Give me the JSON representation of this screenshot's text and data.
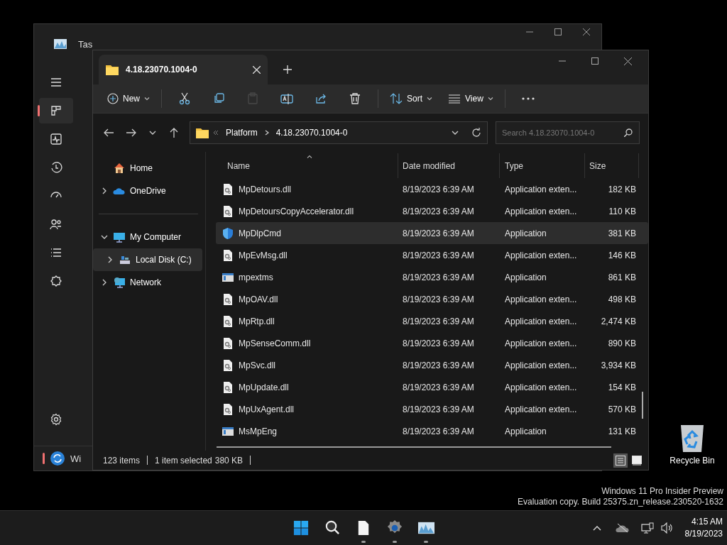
{
  "desktop": {
    "icons": [
      {
        "label": "Recycle Bin"
      }
    ],
    "watermark": [
      "Windows 11 Pro Insider Preview",
      "Evaluation copy. Build 25375.zn_release.230520-1632"
    ]
  },
  "background_window": {
    "title": "Tas",
    "sidebar": [
      {
        "kind": "menu",
        "selected": false
      },
      {
        "kind": "processes",
        "selected": true
      },
      {
        "kind": "performance",
        "selected": false
      },
      {
        "kind": "history",
        "selected": false
      },
      {
        "kind": "startup",
        "selected": false
      },
      {
        "kind": "users",
        "selected": false
      },
      {
        "kind": "details",
        "selected": false
      },
      {
        "kind": "services",
        "selected": false
      }
    ],
    "footer_item": "Wi"
  },
  "explorer": {
    "tab": {
      "title": "4.18.23070.1004-0"
    },
    "toolbar": {
      "new": "New",
      "actions": [
        {
          "kind": "cut",
          "disabled": false
        },
        {
          "kind": "copy",
          "disabled": false
        },
        {
          "kind": "paste",
          "disabled": true
        },
        {
          "kind": "rename",
          "disabled": false
        },
        {
          "kind": "share",
          "disabled": false
        },
        {
          "kind": "delete",
          "disabled": false
        }
      ],
      "sort": "Sort",
      "view": "View"
    },
    "address": {
      "breadcrumbs": [
        "Platform",
        "4.18.23070.1004-0"
      ]
    },
    "search": {
      "placeholder": "Search 4.18.23070.1004-0"
    },
    "navigation": [
      [
        {
          "label": "Home",
          "kind": "home",
          "selected": false
        },
        {
          "label": "OneDrive",
          "kind": "cloud",
          "expanded": false,
          "selected": false
        }
      ],
      [
        {
          "label": "My Computer",
          "kind": "computer",
          "expanded": true,
          "selected": false,
          "children": [
            {
              "label": "Local Disk (C:)",
              "kind": "disk",
              "expanded": false,
              "selected": true
            }
          ]
        },
        {
          "label": "Network",
          "kind": "network",
          "expanded": false,
          "selected": false
        }
      ]
    ],
    "columns": [
      {
        "label": "Name",
        "sorted": true
      },
      {
        "label": "Date modified",
        "sorted": false
      },
      {
        "label": "Type",
        "sorted": false
      },
      {
        "label": "Size",
        "sorted": false
      }
    ],
    "rows": [
      {
        "name": "MpDetours.dll",
        "kind": "dll",
        "date": "8/19/2023 6:39 AM",
        "type": "Application exten...",
        "size": "182 KB",
        "selected": false
      },
      {
        "name": "MpDetoursCopyAccelerator.dll",
        "kind": "dll",
        "date": "8/19/2023 6:39 AM",
        "type": "Application exten...",
        "size": "110 KB",
        "selected": false
      },
      {
        "name": "MpDlpCmd",
        "kind": "shield",
        "date": "8/19/2023 6:39 AM",
        "type": "Application",
        "size": "381 KB",
        "selected": true
      },
      {
        "name": "MpEvMsg.dll",
        "kind": "dll",
        "date": "8/19/2023 6:39 AM",
        "type": "Application exten...",
        "size": "146 KB",
        "selected": false
      },
      {
        "name": "mpextms",
        "kind": "app",
        "date": "8/19/2023 6:39 AM",
        "type": "Application",
        "size": "861 KB",
        "selected": false
      },
      {
        "name": "MpOAV.dll",
        "kind": "dll",
        "date": "8/19/2023 6:39 AM",
        "type": "Application exten...",
        "size": "498 KB",
        "selected": false
      },
      {
        "name": "MpRtp.dll",
        "kind": "dll",
        "date": "8/19/2023 6:39 AM",
        "type": "Application exten...",
        "size": "2,474 KB",
        "selected": false
      },
      {
        "name": "MpSenseComm.dll",
        "kind": "dll",
        "date": "8/19/2023 6:39 AM",
        "type": "Application exten...",
        "size": "890 KB",
        "selected": false
      },
      {
        "name": "MpSvc.dll",
        "kind": "dll",
        "date": "8/19/2023 6:39 AM",
        "type": "Application exten...",
        "size": "3,934 KB",
        "selected": false
      },
      {
        "name": "MpUpdate.dll",
        "kind": "dll",
        "date": "8/19/2023 6:39 AM",
        "type": "Application exten...",
        "size": "154 KB",
        "selected": false
      },
      {
        "name": "MpUxAgent.dll",
        "kind": "dll",
        "date": "8/19/2023 6:39 AM",
        "type": "Application exten...",
        "size": "570 KB",
        "selected": false
      },
      {
        "name": "MsMpEng",
        "kind": "app",
        "date": "8/19/2023 6:39 AM",
        "type": "Application",
        "size": "131 KB",
        "selected": false
      }
    ],
    "status_bar": {
      "count": "123 items",
      "selection": "1 item selected",
      "selection_size": "380 KB",
      "views": [
        {
          "kind": "details",
          "selected": true
        },
        {
          "kind": "tiles",
          "selected": false
        }
      ]
    }
  },
  "taskbar": {
    "apps": [
      {
        "kind": "start",
        "running": false
      },
      {
        "kind": "search",
        "running": false
      },
      {
        "kind": "document",
        "running": true
      },
      {
        "kind": "settings",
        "running": true
      },
      {
        "kind": "monitor",
        "running": true
      }
    ],
    "clock": {
      "time": "4:15 AM",
      "date": "8/19/2023"
    }
  }
}
